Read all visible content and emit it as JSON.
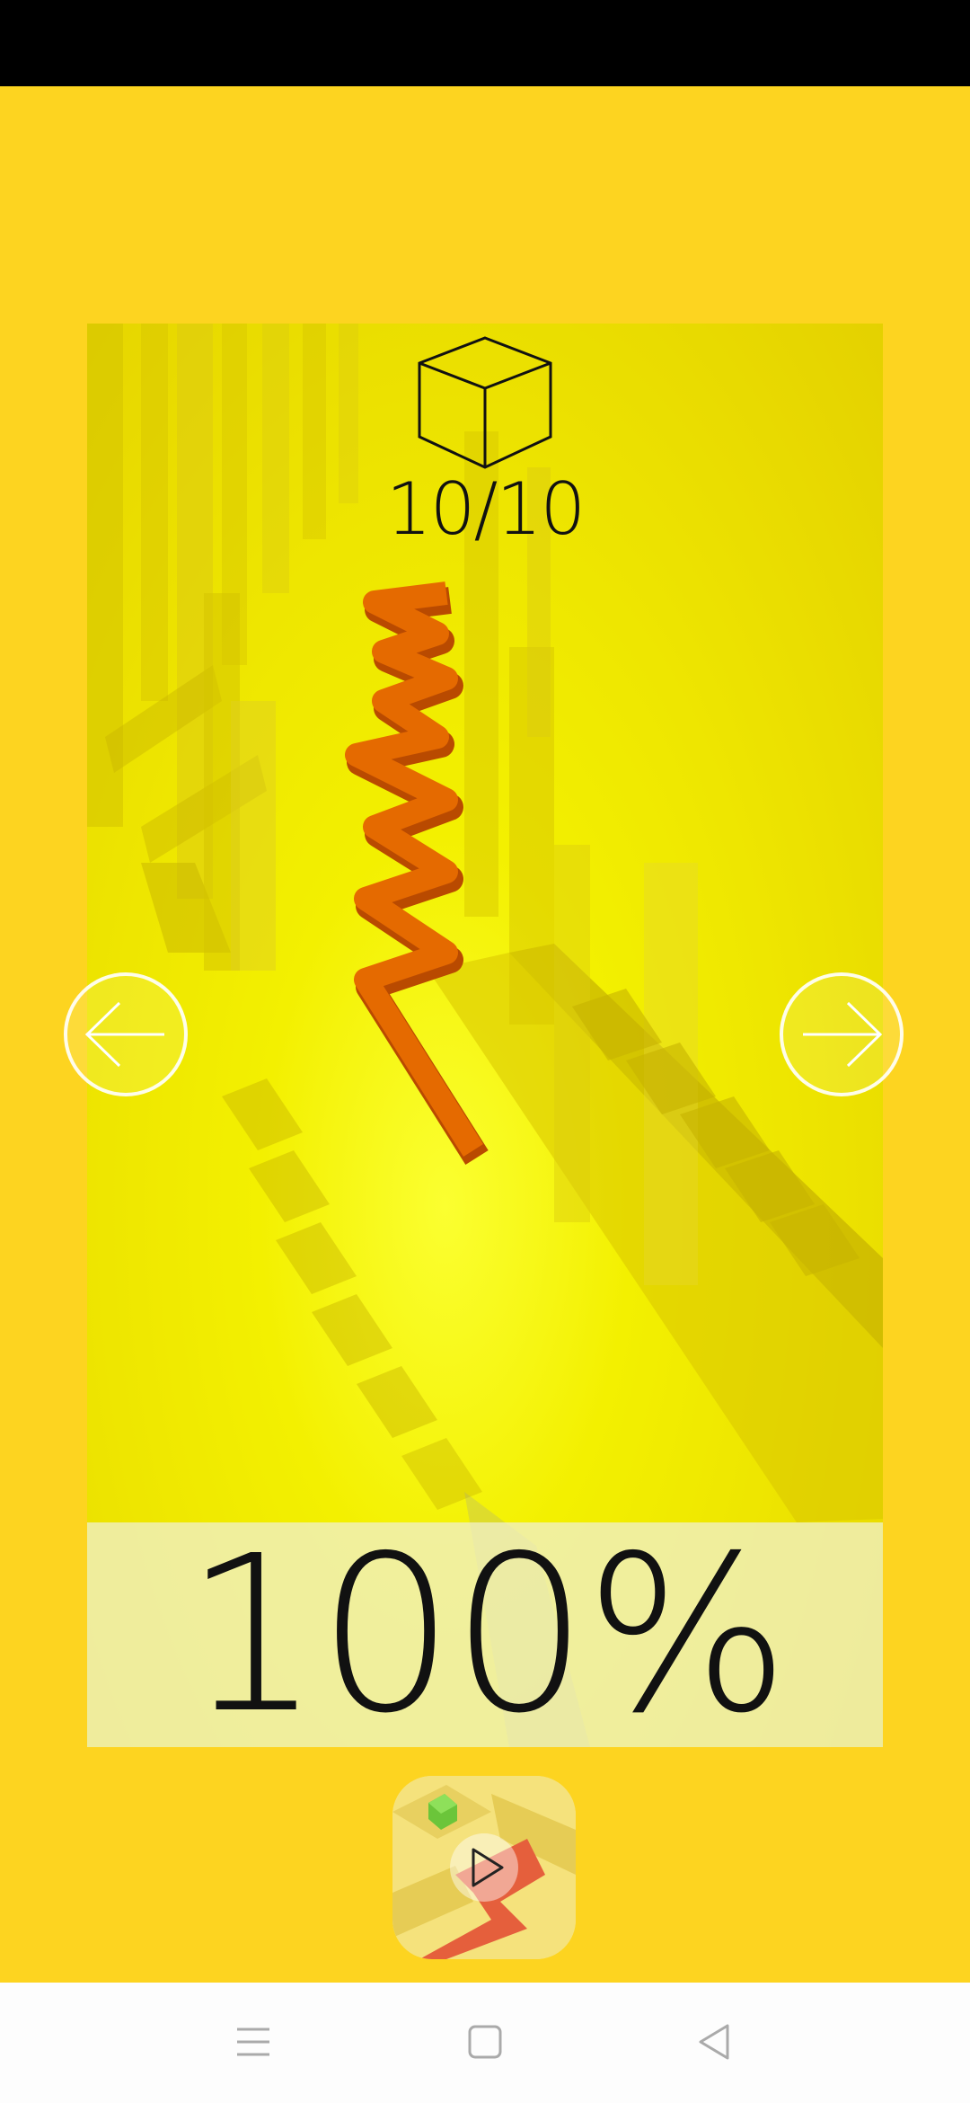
{
  "level": {
    "icon": "cube-icon",
    "progress_text": "10/10"
  },
  "score": {
    "percent_text": "100%"
  },
  "navigation": {
    "previous_icon": "arrow-left-icon",
    "next_icon": "arrow-right-icon",
    "play_icon": "play-icon"
  },
  "system_nav": {
    "menu_icon": "menu-icon",
    "home_icon": "square-home-icon",
    "back_icon": "back-triangle-icon"
  },
  "colors": {
    "background": "#FDD420",
    "path": "#E56A00",
    "status_bar": "#000000",
    "nav_bar": "#FDFDFD"
  }
}
